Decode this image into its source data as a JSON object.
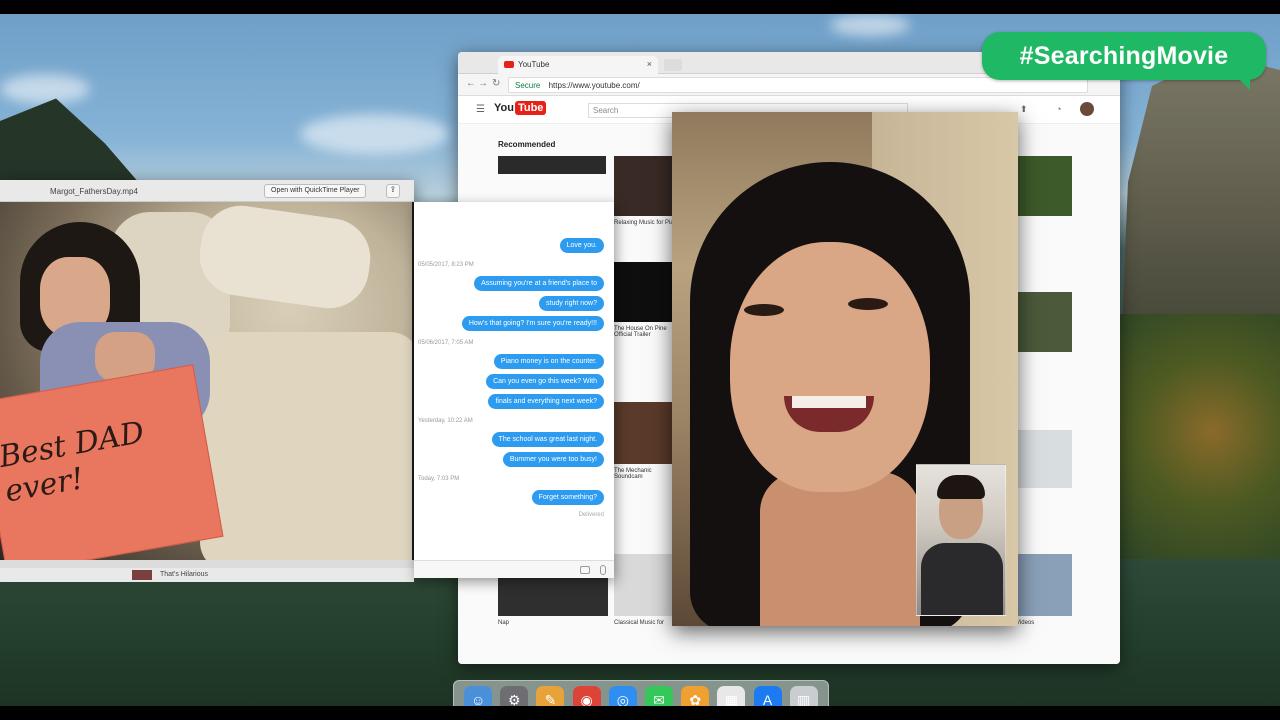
{
  "hashtag": "#SearchingMovie",
  "browser": {
    "tab_title": "YouTube",
    "secure_label": "Secure",
    "url": "https://www.youtube.com/",
    "youtube": {
      "logo_you": "You",
      "logo_tube": "Tube",
      "search_placeholder": "Search",
      "recommended_label": "Recommended",
      "videos": [
        {
          "title": "Relaxing Music for Piano"
        },
        {
          "title": "The House On Pine Official Trailer"
        },
        {
          "title": "The Mechanic Soundcam"
        },
        {
          "title": "Nap"
        },
        {
          "title": "Classical Music for"
        },
        {
          "title": "Videos"
        }
      ]
    }
  },
  "player": {
    "filename": "Margot_FathersDay.mp4",
    "open_with_label": "Open with QuickTime Player",
    "card_text": "Best DAD ever!",
    "strip_label": "That's Hilarious"
  },
  "messages": {
    "items": [
      {
        "kind": "bubble",
        "text": "Love you."
      },
      {
        "kind": "timestamp",
        "text": "05/05/2017, 8:23 PM"
      },
      {
        "kind": "bubble",
        "text": "Assuming you're at a friend's place to"
      },
      {
        "kind": "bubble",
        "text": "study right now?"
      },
      {
        "kind": "bubble",
        "text": "How's that going? I'm sure you're ready!!!"
      },
      {
        "kind": "timestamp",
        "text": "05/06/2017, 7:05 AM"
      },
      {
        "kind": "bubble",
        "text": "Piano money is on the counter."
      },
      {
        "kind": "bubble",
        "text": "Can you even go this week? With"
      },
      {
        "kind": "bubble",
        "text": "finals and everything next week?"
      },
      {
        "kind": "timestamp",
        "text": "Yesterday, 10:22 AM"
      },
      {
        "kind": "bubble",
        "text": "The school was great last night."
      },
      {
        "kind": "bubble",
        "text": "Bummer you were too busy!"
      },
      {
        "kind": "timestamp",
        "text": "Today, 7:03 PM"
      },
      {
        "kind": "bubble",
        "text": "Forget something?"
      }
    ],
    "delivered": "Delivered"
  },
  "dock": {
    "icons": [
      "finder-icon",
      "system-preferences-icon",
      "notes-icon",
      "chrome-icon",
      "safari-icon",
      "messages-icon",
      "photos-icon",
      "calendar-icon",
      "app-store-icon",
      "trash-icon"
    ]
  }
}
